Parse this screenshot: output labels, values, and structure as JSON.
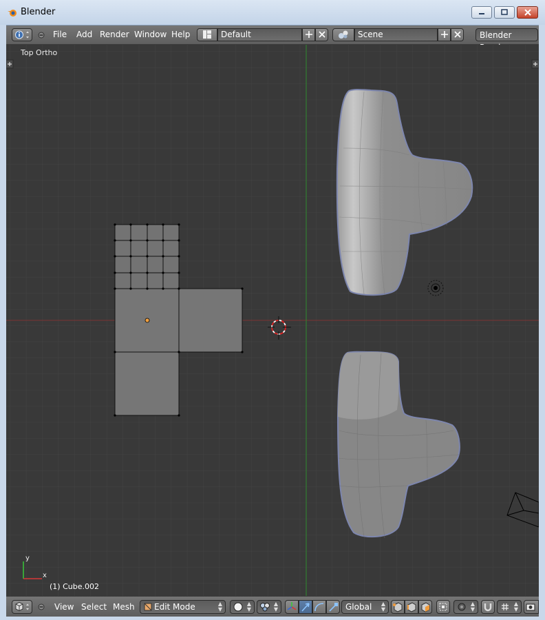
{
  "window": {
    "title": "Blender",
    "minimize": "–",
    "maximize": "▭",
    "close": "✕"
  },
  "menu": {
    "items": [
      "File",
      "Add",
      "Render",
      "Window",
      "Help"
    ],
    "layout_value": "Default",
    "scene_value": "Scene",
    "render_engine": "Blender Render"
  },
  "viewport": {
    "view_label": "Top Ortho",
    "object_label": "(1) Cube.002",
    "axis_x": "x",
    "axis_y": "y"
  },
  "bottom": {
    "menu": [
      "View",
      "Select",
      "Mesh"
    ],
    "mode_value": "Edit Mode",
    "orientation_value": "Global"
  },
  "colors": {
    "viewport_bg": "#393939",
    "grid": "#444444",
    "x_axis": "#7a3434",
    "y_axis": "#2e8a2e",
    "mesh_face": "#787878",
    "header": "#6b6b6b"
  }
}
